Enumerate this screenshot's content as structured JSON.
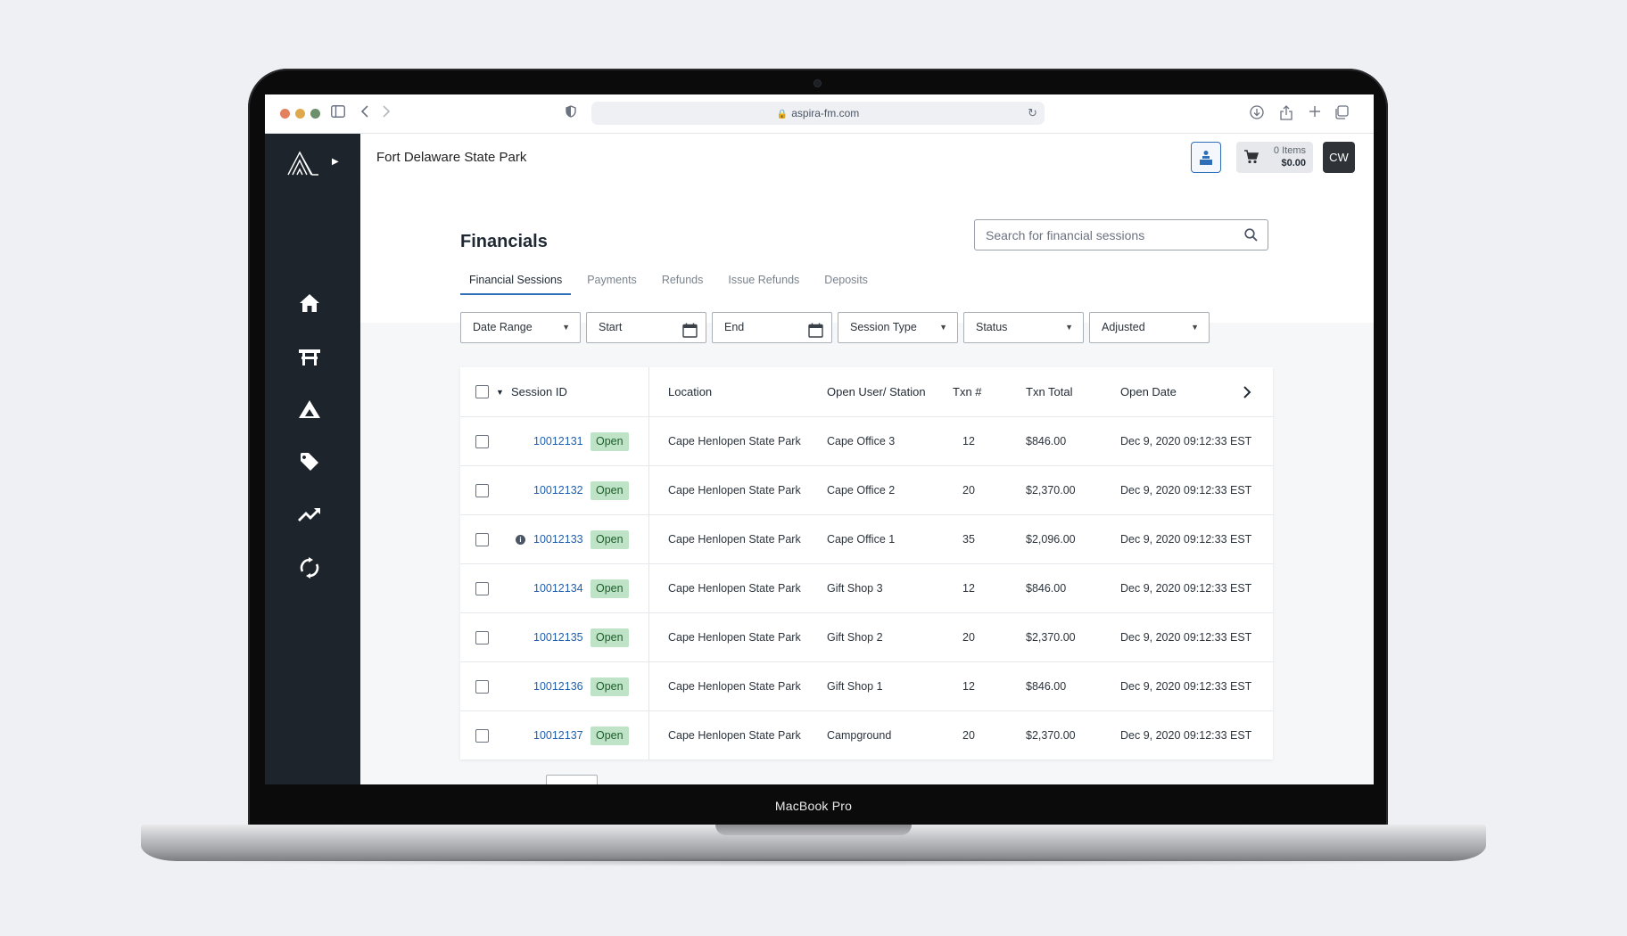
{
  "device": {
    "brand": "MacBook Pro"
  },
  "browser": {
    "url": "aspira-fm.com"
  },
  "header": {
    "park_name": "Fort Delaware State Park",
    "cart_items": "0 Items",
    "cart_total": "$0.00",
    "avatar_initials": "CW"
  },
  "sidebar": {
    "items": [
      {
        "icon": "home-icon"
      },
      {
        "icon": "picnic-table-icon"
      },
      {
        "icon": "tent-icon"
      },
      {
        "icon": "tag-icon"
      },
      {
        "icon": "trending-up-icon"
      },
      {
        "icon": "sync-icon"
      }
    ]
  },
  "page": {
    "title": "Financials",
    "search_placeholder": "Search for financial sessions",
    "tabs": [
      "Financial Sessions",
      "Payments",
      "Refunds",
      "Issue Refunds",
      "Deposits"
    ],
    "active_tab": "Financial Sessions"
  },
  "filters": {
    "date_range": "Date Range",
    "start": "Start",
    "end": "End",
    "session_type": "Session Type",
    "status": "Status",
    "adjusted": "Adjusted"
  },
  "table": {
    "columns": [
      "Session ID",
      "Location",
      "Open User/ Station",
      "Txn #",
      "Txn Total",
      "Open Date"
    ],
    "rows": [
      {
        "id": "10012131",
        "status": "Open",
        "location": "Cape Henlopen State Park",
        "station": "Cape Office 3",
        "txn": "12",
        "total": "$846.00",
        "date": "Dec 9, 2020 09:12:33 EST"
      },
      {
        "id": "10012132",
        "status": "Open",
        "location": "Cape Henlopen State Park",
        "station": "Cape Office 2",
        "txn": "20",
        "total": "$2,370.00",
        "date": "Dec 9, 2020 09:12:33 EST"
      },
      {
        "id": "10012133",
        "status": "Open",
        "location": "Cape Henlopen State Park",
        "station": "Cape Office 1",
        "txn": "35",
        "total": "$2,096.00",
        "date": "Dec 9, 2020 09:12:33 EST",
        "info": true
      },
      {
        "id": "10012134",
        "status": "Open",
        "location": "Cape Henlopen State Park",
        "station": "Gift Shop 3",
        "txn": "12",
        "total": "$846.00",
        "date": "Dec 9, 2020 09:12:33 EST"
      },
      {
        "id": "10012135",
        "status": "Open",
        "location": "Cape Henlopen State Park",
        "station": "Gift Shop 2",
        "txn": "20",
        "total": "$2,370.00",
        "date": "Dec 9, 2020 09:12:33 EST"
      },
      {
        "id": "10012136",
        "status": "Open",
        "location": "Cape Henlopen State Park",
        "station": "Gift Shop 1",
        "txn": "12",
        "total": "$846.00",
        "date": "Dec 9, 2020 09:12:33 EST"
      },
      {
        "id": "10012137",
        "status": "Open",
        "location": "Cape Henlopen State Park",
        "station": "Campground",
        "txn": "20",
        "total": "$2,370.00",
        "date": "Dec 9, 2020 09:12:33 EST"
      }
    ]
  },
  "colors": {
    "sidebar_bg": "#1d242c",
    "link": "#1f5fae",
    "status_open_bg": "#bfe3c6",
    "accent": "#2e6fb7"
  }
}
